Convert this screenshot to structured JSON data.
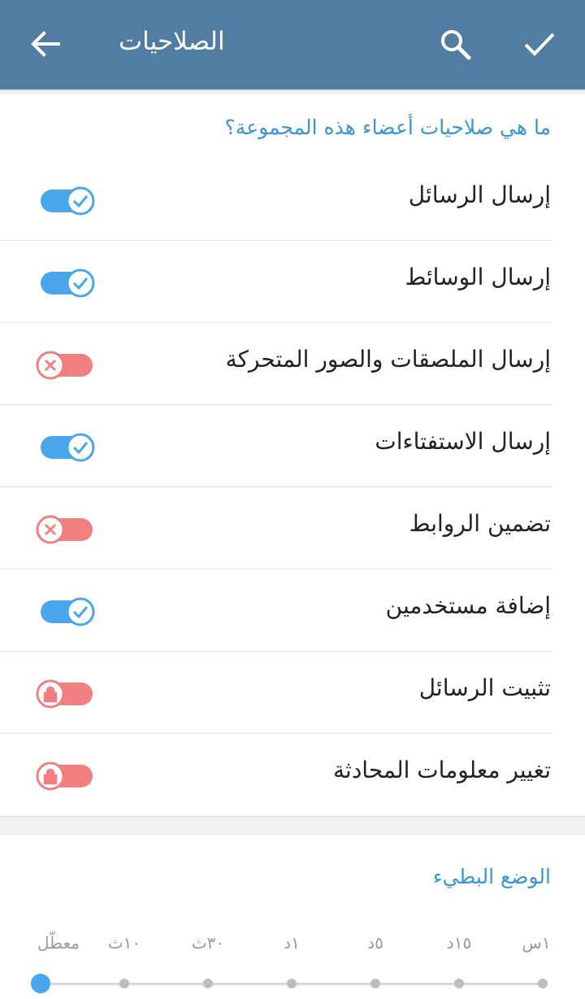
{
  "topbar": {
    "title": "الصلاحيات",
    "back_icon": "arrow-back-icon",
    "search_icon": "search-icon",
    "done_icon": "check-icon"
  },
  "permissions": {
    "header": "ما هي صلاحيات أعضاء هذه المجموعة؟",
    "items": [
      {
        "label": "إرسال الرسائل",
        "state": "on"
      },
      {
        "label": "إرسال الوسائط",
        "state": "on"
      },
      {
        "label": "إرسال الملصقات والصور المتحركة",
        "state": "off"
      },
      {
        "label": "إرسال الاستفتاءات",
        "state": "on"
      },
      {
        "label": "تضمين الروابط",
        "state": "off"
      },
      {
        "label": "إضافة مستخدمين",
        "state": "on"
      },
      {
        "label": "تثبيت الرسائل",
        "state": "locked"
      },
      {
        "label": "تغيير معلومات المحادثة",
        "state": "locked"
      }
    ]
  },
  "slow_mode": {
    "title": "الوضع البطيء",
    "options": [
      "معطّل",
      "١٠ث",
      "٣٠ث",
      "١د",
      "٥د",
      "١٥د",
      "١س"
    ],
    "selected_index": 0
  },
  "colors": {
    "topbar": "#527da3",
    "accent": "#3a95d5",
    "switch_on": "#4aa6ea",
    "switch_off": "#f08080"
  }
}
